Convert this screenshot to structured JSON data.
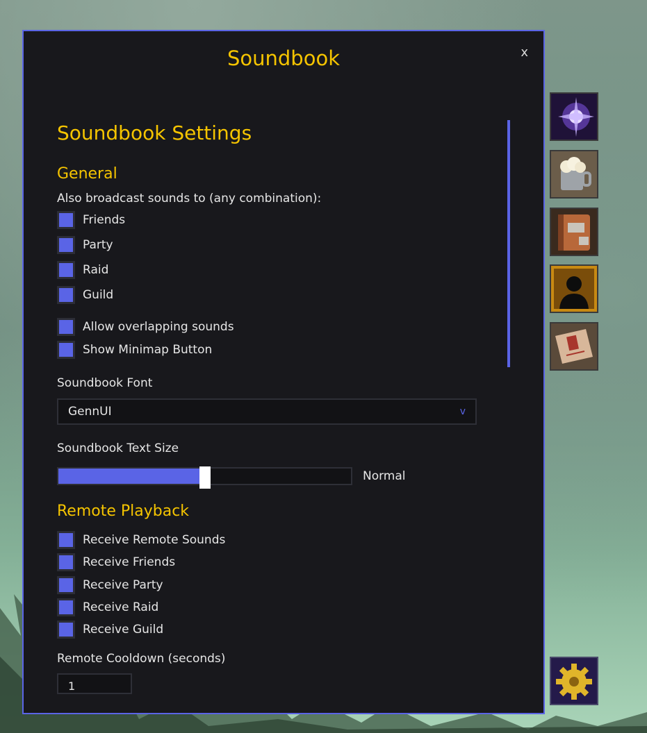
{
  "window": {
    "title": "Soundbook",
    "close_label": "x"
  },
  "settings": {
    "heading": "Soundbook Settings",
    "general": {
      "heading": "General",
      "broadcast_label": "Also broadcast sounds to (any combination):",
      "broadcast_options": [
        {
          "label": "Friends",
          "checked": true
        },
        {
          "label": "Party",
          "checked": true
        },
        {
          "label": "Raid",
          "checked": true
        },
        {
          "label": "Guild",
          "checked": true
        }
      ],
      "allow_overlapping": {
        "label": "Allow overlapping sounds",
        "checked": true
      },
      "show_minimap": {
        "label": "Show Minimap Button",
        "checked": true
      }
    },
    "font": {
      "label": "Soundbook Font",
      "value": "GennUI",
      "chevron": "v"
    },
    "text_size": {
      "label": "Soundbook Text Size",
      "value_label": "Normal",
      "fraction": 0.5
    },
    "remote": {
      "heading": "Remote Playback",
      "options": [
        {
          "label": "Receive Remote Sounds",
          "checked": true
        },
        {
          "label": "Receive Friends",
          "checked": true
        },
        {
          "label": "Receive Party",
          "checked": true
        },
        {
          "label": "Receive Raid",
          "checked": true
        },
        {
          "label": "Receive Guild",
          "checked": true
        }
      ],
      "cooldown_label": "Remote Cooldown (seconds)",
      "cooldown_value": "1"
    }
  },
  "sidebar_icons": [
    {
      "name": "arcane-burst-icon"
    },
    {
      "name": "ale-mug-icon"
    },
    {
      "name": "spellbook-icon"
    },
    {
      "name": "character-portrait-icon"
    },
    {
      "name": "scroll-icon"
    },
    {
      "name": "settings-gear-icon"
    }
  ],
  "colors": {
    "accent": "#5a64e6",
    "title": "#f5c400",
    "panel": "#18181c"
  }
}
